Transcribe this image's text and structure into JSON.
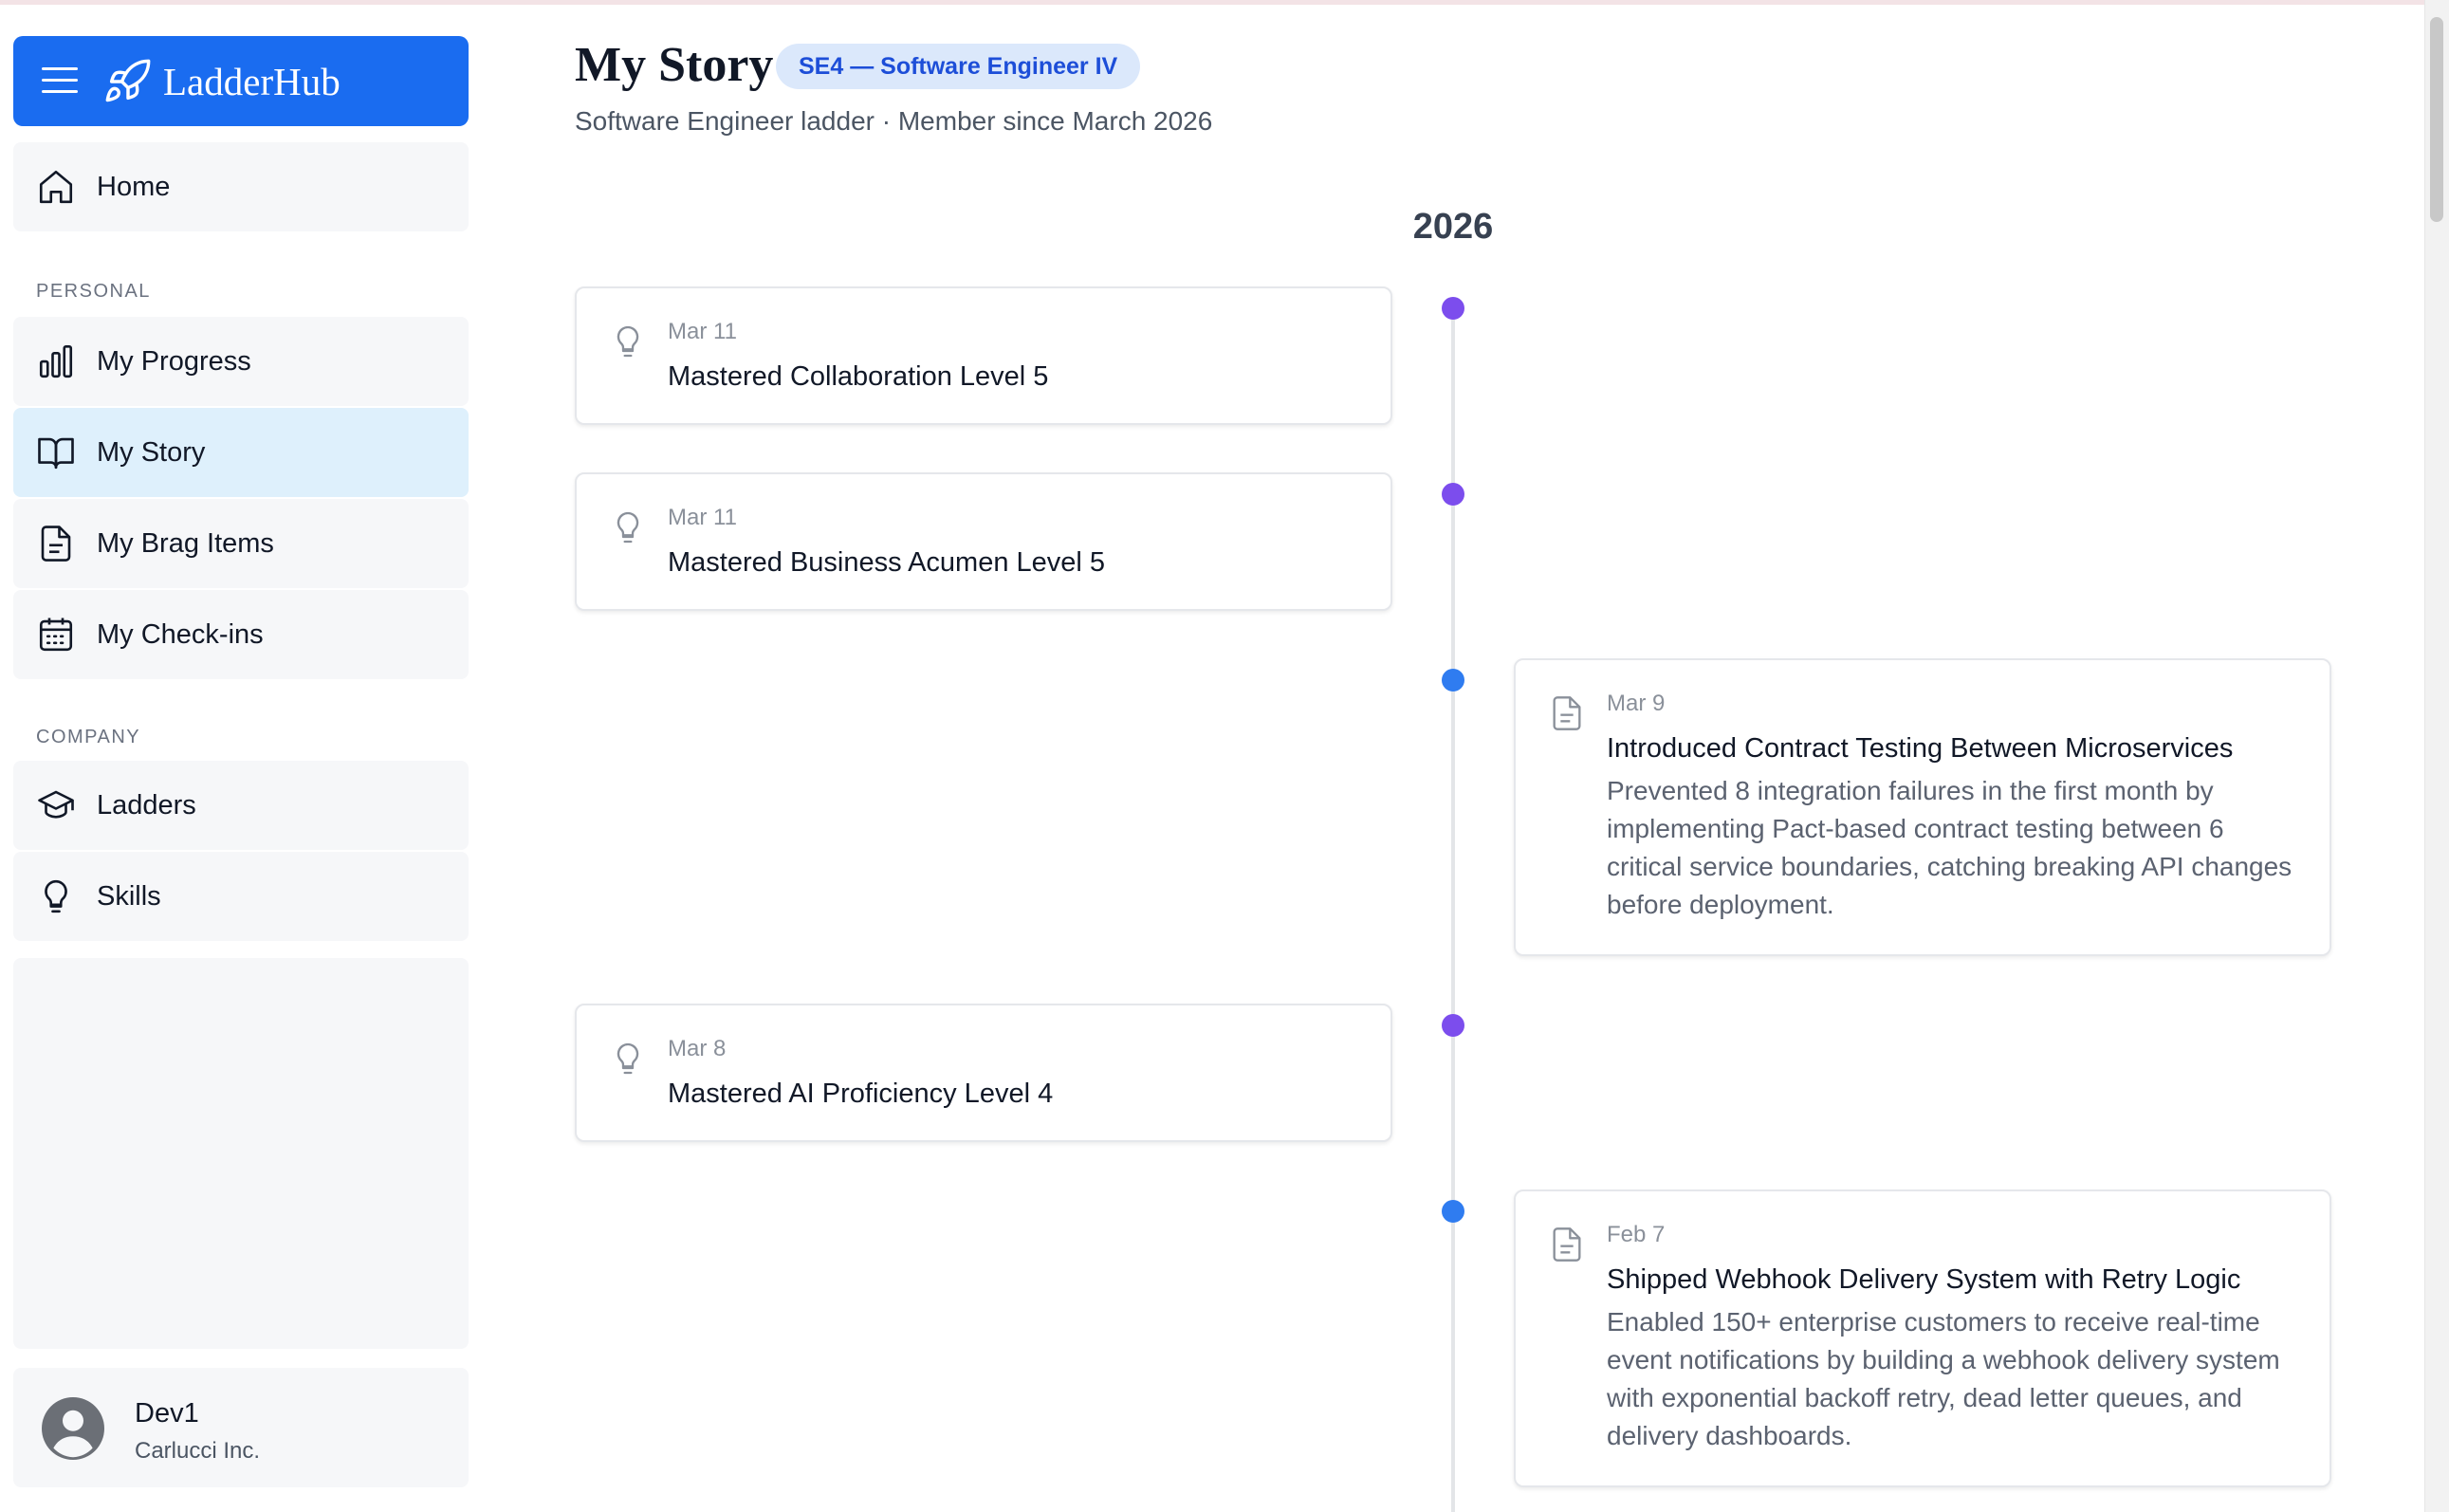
{
  "app": {
    "brand": "LadderHub",
    "accent_color": "#1a6cf0"
  },
  "sidebar": {
    "home": {
      "label": "Home",
      "icon": "home-icon"
    },
    "personal_section": "PERSONAL",
    "personal_items": [
      {
        "label": "My Progress",
        "icon": "bar-chart-icon",
        "active": false
      },
      {
        "label": "My Story",
        "icon": "book-icon",
        "active": true
      },
      {
        "label": "My Brag Items",
        "icon": "document-icon",
        "active": false
      },
      {
        "label": "My Check-ins",
        "icon": "calendar-icon",
        "active": false
      }
    ],
    "company_section": "COMPANY",
    "company_items": [
      {
        "label": "Ladders",
        "icon": "graduation-cap-icon"
      },
      {
        "label": "Skills",
        "icon": "lightbulb-icon"
      }
    ],
    "user": {
      "name": "Dev1",
      "company": "Carlucci Inc."
    }
  },
  "main": {
    "title": "My Story",
    "level_badge": "SE4 — Software Engineer IV",
    "subtitle": "Software Engineer ladder · Member since March 2026",
    "year": "2026",
    "events": [
      {
        "type": "skill",
        "side": "left",
        "date": "Mar 11",
        "title": "Mastered Collaboration Level 5",
        "description": ""
      },
      {
        "type": "skill",
        "side": "left",
        "date": "Mar 11",
        "title": "Mastered Business Acumen Level 5",
        "description": ""
      },
      {
        "type": "brag",
        "side": "right",
        "date": "Mar 9",
        "title": "Introduced Contract Testing Between Microservices",
        "description": "Prevented 8 integration failures in the first month by implementing Pact-based contract testing between 6 critical service boundaries, catching breaking API changes before deployment."
      },
      {
        "type": "skill",
        "side": "left",
        "date": "Mar 8",
        "title": "Mastered AI Proficiency Level 4",
        "description": ""
      },
      {
        "type": "brag",
        "side": "right",
        "date": "Feb 7",
        "title": "Shipped Webhook Delivery System with Retry Logic",
        "description": "Enabled 150+ enterprise customers to receive real-time event notifications by building a webhook delivery system with exponential backoff retry, dead letter queues, and delivery dashboards."
      }
    ]
  },
  "colors": {
    "skill_dot": "#7c4ded",
    "brag_dot": "#2f7cf0",
    "active_nav": "#def0fc",
    "badge_bg": "#dbe8fb",
    "badge_text": "#1d4ed8"
  }
}
